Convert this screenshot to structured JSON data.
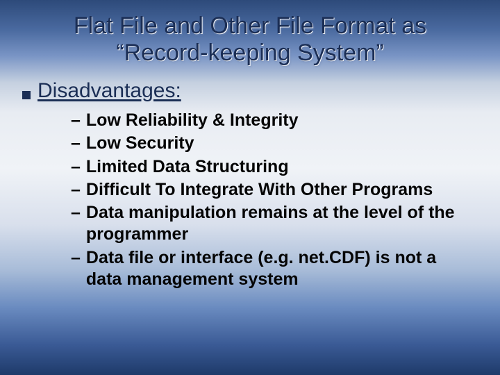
{
  "title": "Flat File and Other File Format as “Record-keeping System”",
  "section": {
    "heading": "Disadvantages:",
    "items": [
      "Low Reliability & Integrity",
      "Low Security",
      "Limited Data Structuring",
      "Difficult To Integrate With Other Programs",
      "Data manipulation remains at the level of the programmer",
      "Data file or interface (e.g. net.CDF) is not a data management system"
    ]
  }
}
